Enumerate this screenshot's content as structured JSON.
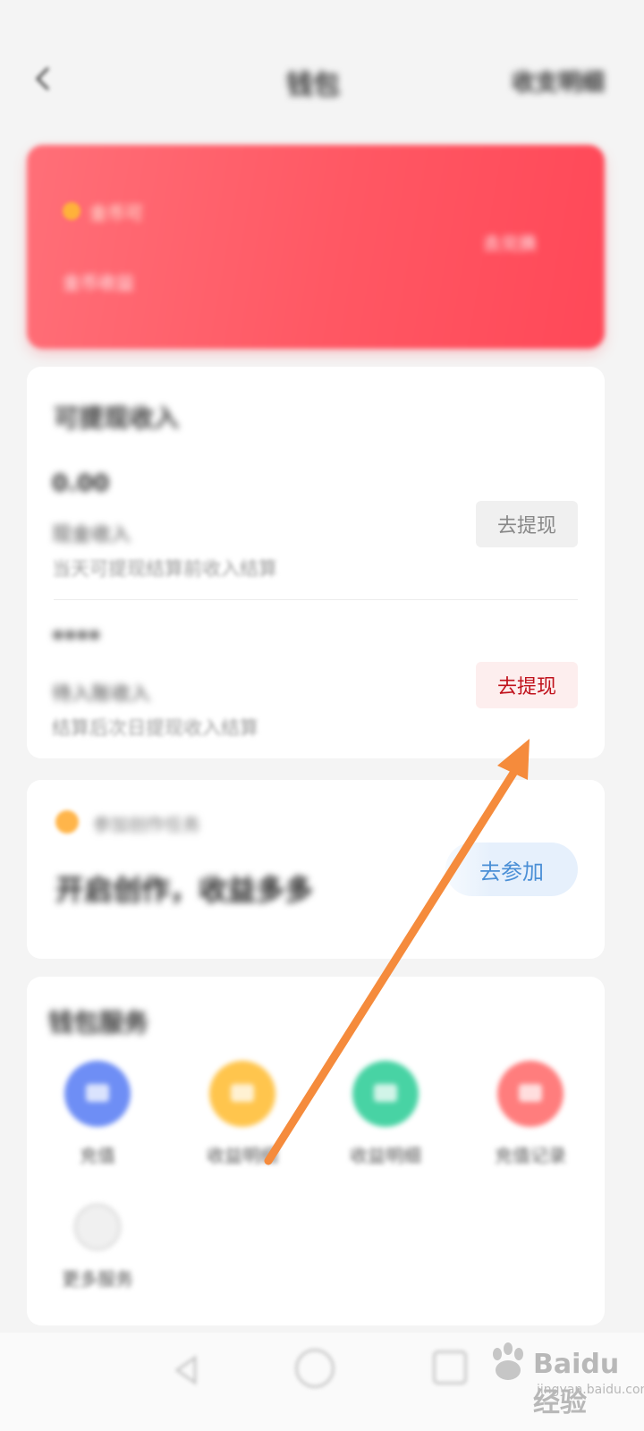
{
  "header": {
    "title": "钱包",
    "right_link": "收支明细"
  },
  "banner": {
    "tag": "金币可",
    "label": "金币收益",
    "right_text": "去兑换"
  },
  "income": {
    "section_title": "可提现收入",
    "row1": {
      "amount": "0.00",
      "subtitle": "现金收入",
      "note": "当天可提现结算前收入结算",
      "button": "去提现"
    },
    "row2": {
      "amount": "****",
      "subtitle": "待入账收入",
      "note": "结算后次日提现收入结算",
      "button": "去提现"
    }
  },
  "promo": {
    "tag": "参加创作任务",
    "headline": "开启创作，收益多多",
    "button": "去参加"
  },
  "services": {
    "section_title": "钱包服务",
    "items": [
      {
        "label": "充值",
        "icon": "wallet-icon",
        "color": "#6e8ef5"
      },
      {
        "label": "收益明细",
        "icon": "coin-icon",
        "color": "#ffc54d"
      },
      {
        "label": "收益明细",
        "icon": "chart-icon",
        "color": "#48d3a4"
      },
      {
        "label": "充值记录",
        "icon": "record-icon",
        "color": "#ff7d7d"
      },
      {
        "label": "更多服务",
        "icon": "more-icon",
        "color": "#d0d0d0"
      }
    ]
  },
  "watermark": {
    "brand": "Baidu经验",
    "url": "jingyan.baidu.com"
  },
  "colors": {
    "banner_red": "#ff5763",
    "withdraw_active": "#c0121c",
    "join_blue": "#4a8fd6",
    "annotation_arrow": "#f58b3c"
  }
}
